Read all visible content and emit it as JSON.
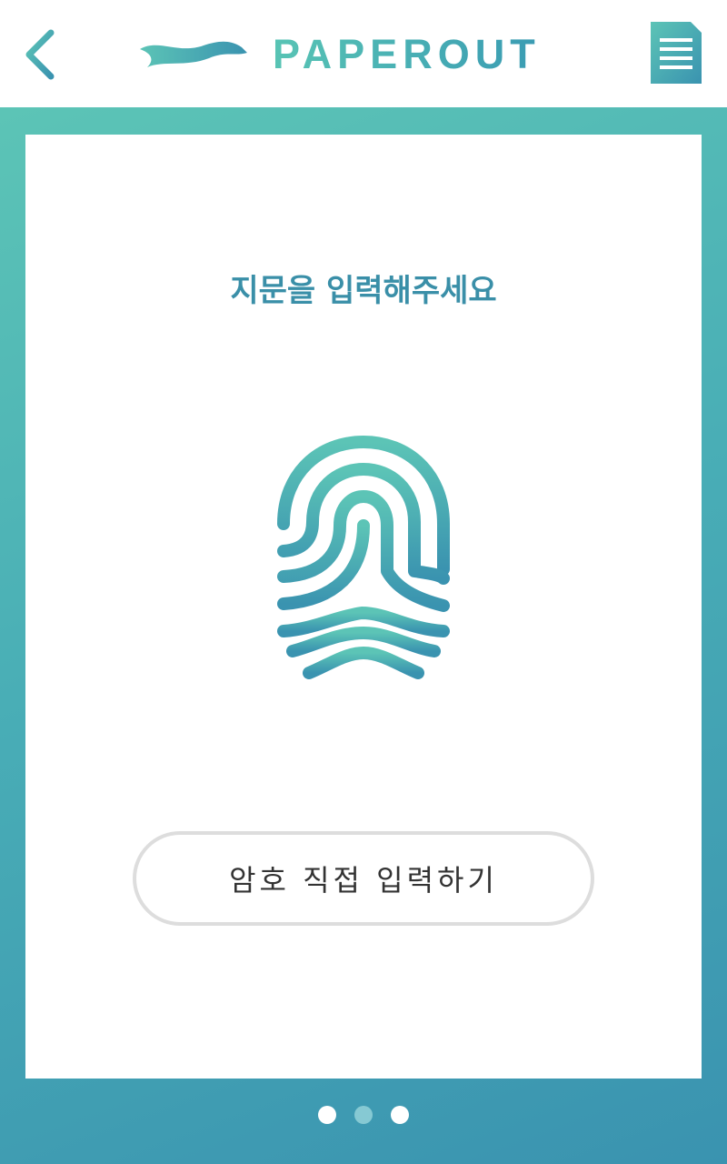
{
  "header": {
    "back_icon": "chevron-left-icon",
    "logo_text": "PAPEROUT",
    "menu_icon": "document-list-icon"
  },
  "main": {
    "prompt": "지문을 입력해주세요",
    "fingerprint_icon": "fingerprint-icon",
    "password_button_label": "암호 직접 입력하기"
  },
  "pagination": {
    "total": 3,
    "active_index": 1
  },
  "colors": {
    "brand_start": "#5cc4b6",
    "brand_end": "#3a93b0",
    "prompt_text": "#3a8fa8",
    "active_dot": "#86c9d3"
  }
}
